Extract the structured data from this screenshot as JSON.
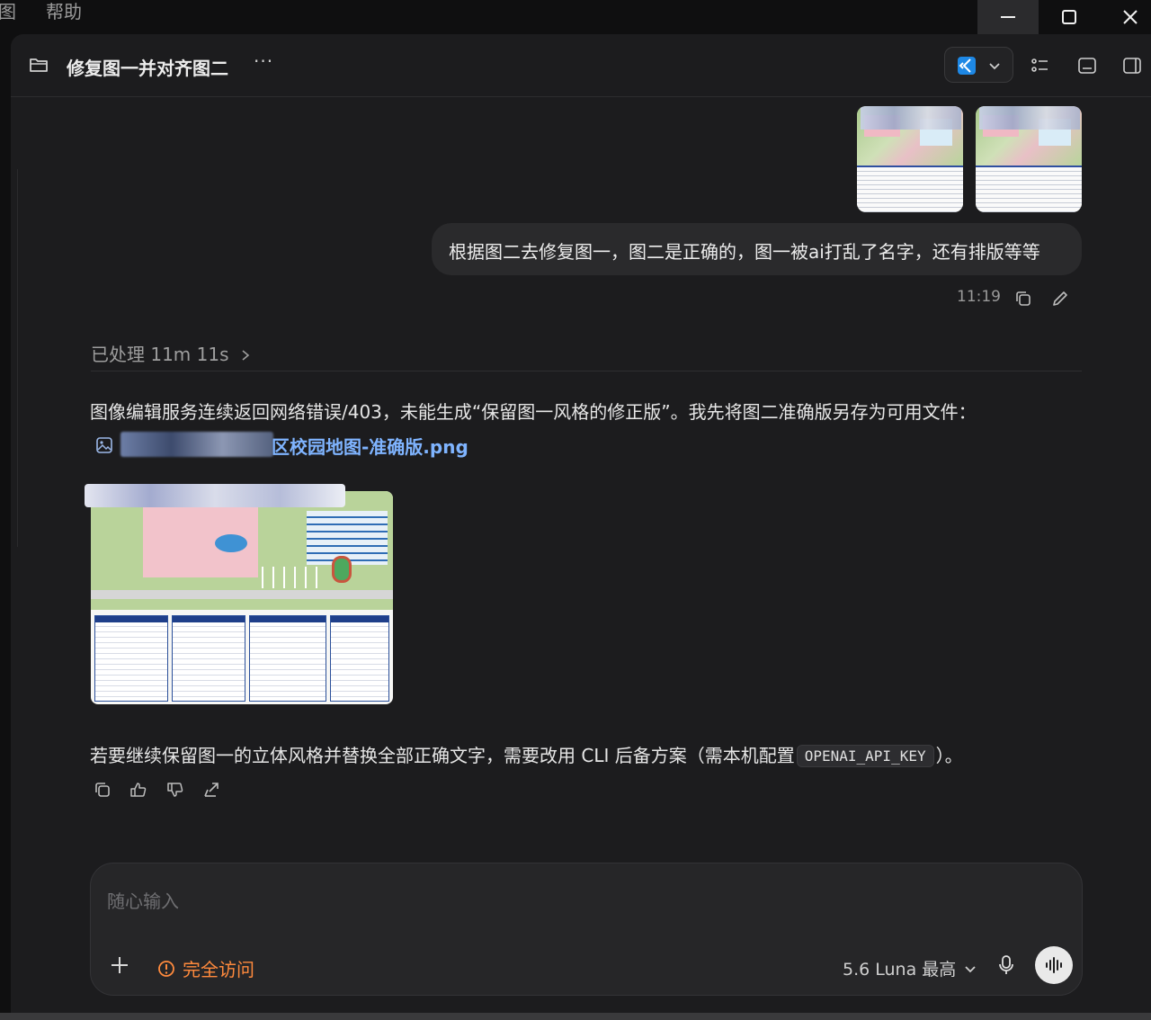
{
  "menubar": {
    "item1": "图",
    "item2": "帮助"
  },
  "window_controls": {
    "minimize": "—",
    "maximize": "☐",
    "close": "✕"
  },
  "header": {
    "title": "修复图一并对齐图二",
    "more": "···",
    "editor_icon": "vscode-icon",
    "accent": "#1e88e5"
  },
  "user_message": {
    "text": "根据图二去修复图一，图二是正确的，图一被ai打乱了名字，还有排版等等",
    "time": "11:19"
  },
  "assistant": {
    "processed_label": "已处理 11m 11s",
    "paragraph1": "图像编辑服务连续返回网络错误/403，未能生成“保留图一风格的修正版”。我先将图二准确版另存为可用文件：",
    "file_name_visible": "区校园地图-准确版.png",
    "paragraph2_before": "若要继续保留图一的立体风格并替换全部正确文字，需要改用 CLI 后备方案（需本机配置",
    "code": "OPENAI_API_KEY",
    "paragraph2_after": "）。"
  },
  "composer": {
    "placeholder": "随心输入",
    "access_label": "完全访问",
    "model_label": "5.6 Luna 最高",
    "access_color": "#ff8a3d"
  },
  "colors": {
    "link": "#78b0ff",
    "panel": "#1c1c1e",
    "bubble": "#2a2a2c"
  }
}
